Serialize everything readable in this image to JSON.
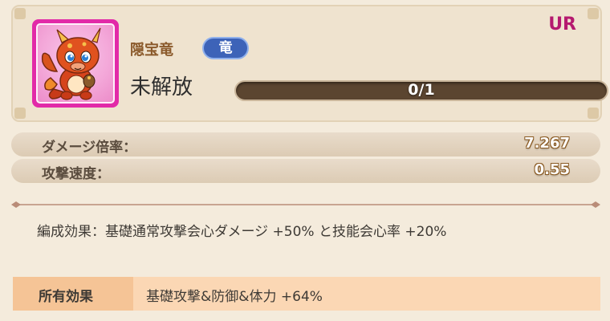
{
  "header": {
    "rarity": "UR",
    "name": "隠宝竜",
    "type_tag": "竜",
    "status": "未解放",
    "progress": {
      "current": 0,
      "total": 1,
      "label": "0/1"
    },
    "colors": {
      "rarity": "#b5196f",
      "tag": "#3d63b8",
      "portrait_frame": "#e22aa8"
    }
  },
  "stats": [
    {
      "label": "ダメージ倍率：",
      "value": "7.267"
    },
    {
      "label": "攻撃速度：",
      "value": "0.55"
    }
  ],
  "formation_effect": "編成効果：基礎通常攻撃会心ダメージ +50% と技能会心率 +20%",
  "owned_effect": {
    "title": "所有効果",
    "text": "基礎攻撃&防御&体力 +64%"
  },
  "icons": {
    "portrait": "red-dragon-character-icon"
  }
}
